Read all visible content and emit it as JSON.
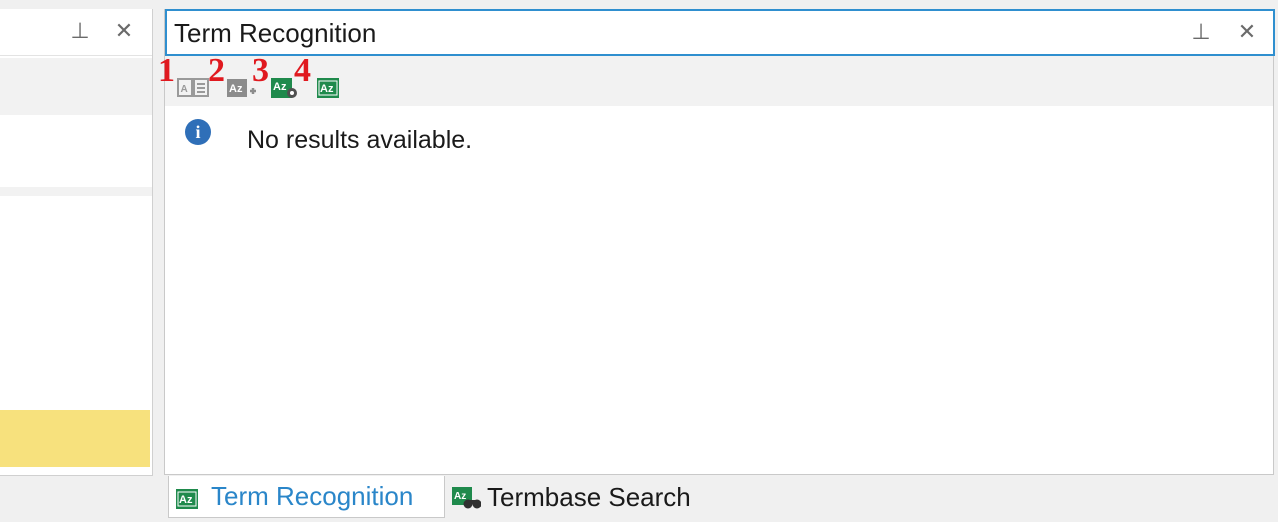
{
  "left_panel": {
    "pin_label": "⊥",
    "close_label": "✕"
  },
  "term_panel": {
    "title": "Term Recognition",
    "pin_label": "⊥",
    "close_label": "✕",
    "toolbar": {
      "callouts": [
        "1",
        "2",
        "3",
        "4"
      ],
      "buttons": [
        {
          "icon": "term-details-icon",
          "color": "#9a9a9a"
        },
        {
          "icon": "add-term-icon",
          "color": "#8c8c8c"
        },
        {
          "icon": "termbase-settings-icon",
          "color": "#1f8a4c"
        },
        {
          "icon": "termbase-icon",
          "color": "#1f8a4c"
        }
      ]
    },
    "message": "No results available."
  },
  "tabs": [
    {
      "label": "Term Recognition",
      "active": true,
      "icon": "termbase-icon"
    },
    {
      "label": "Termbase Search",
      "active": false,
      "icon": "termbase-search-icon"
    }
  ],
  "colors": {
    "accent": "#2f8fcf",
    "callout_red": "#e0191f",
    "termbase_green": "#1f8a4c",
    "highlight_yellow": "#f7e17d"
  }
}
